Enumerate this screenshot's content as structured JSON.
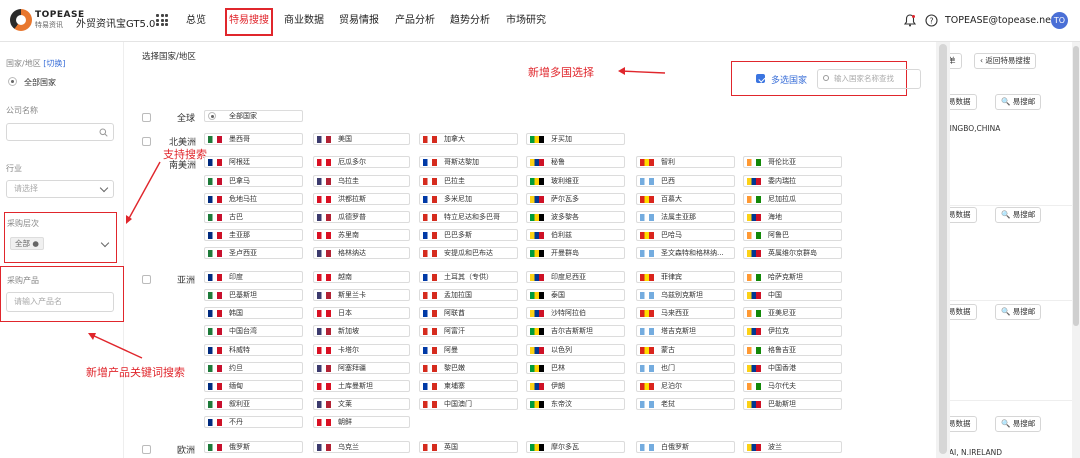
{
  "header": {
    "brand_name": "TOPEASE",
    "brand_sub": "特易资讯",
    "product": "外贸资讯宝GT5.0",
    "nav": [
      "总览",
      "特易搜搜",
      "商业数据",
      "贸易情报",
      "产品分析",
      "趋势分析",
      "市场研究"
    ],
    "active_nav": "特易搜搜",
    "email": "TOPEASE@topease.net",
    "avatar": "TO"
  },
  "left": {
    "region_label": "国家/地区",
    "switch_link": "[切换]",
    "region_value": "全部国家",
    "company_label": "公司名称",
    "industry_label": "行业",
    "industry_placeholder": "请选择",
    "level_label": "采购层次",
    "level_tag": "全部",
    "product_label": "采购产品",
    "product_placeholder": "请输入产品名"
  },
  "main": {
    "title": "选择国家/地区",
    "multi_label": "多选国家",
    "search_placeholder": "输入国家名称查找",
    "annotations": {
      "multi": "新增多国选择",
      "search": "支持搜索",
      "keyword": "新增产品关键词搜索"
    },
    "all_label": "全球",
    "all_value": "全部国家",
    "regions": {
      "north_america": "北美洲",
      "south_america": "南美洲",
      "asia": "亚洲",
      "europe": "欧洲"
    },
    "rows": {
      "na": [
        "墨西哥",
        "美国",
        "加拿大",
        "牙买加"
      ],
      "sa1": [
        "阿根廷",
        "厄瓜多尔",
        "哥斯达黎加",
        "秘鲁",
        "智利",
        "哥伦比亚"
      ],
      "sa2": [
        "巴拿马",
        "乌拉圭",
        "巴拉圭",
        "玻利维亚",
        "巴西",
        "委内瑞拉"
      ],
      "sa3": [
        "危地马拉",
        "洪都拉斯",
        "多米尼加",
        "萨尔瓦多",
        "百慕大",
        "尼加拉瓜"
      ],
      "sa4": [
        "古巴",
        "瓜德罗普",
        "特立尼达和多巴哥",
        "波多黎各",
        "法属圭亚那",
        "海地"
      ],
      "sa5": [
        "圭亚那",
        "苏里南",
        "巴巴多斯",
        "伯利兹",
        "巴哈马",
        "阿鲁巴"
      ],
      "sa6": [
        "圣卢西亚",
        "格林纳达",
        "安提瓜和巴布达",
        "开曼群岛",
        "圣文森特和格林纳...",
        "英属维尔京群岛"
      ],
      "as1": [
        "印度",
        "越南",
        "土耳其（专供）",
        "印度尼西亚",
        "菲律宾",
        "哈萨克斯坦"
      ],
      "as2": [
        "巴基斯坦",
        "斯里兰卡",
        "孟加拉国",
        "泰国",
        "乌兹别克斯坦",
        "中国"
      ],
      "as3": [
        "韩国",
        "日本",
        "阿联酋",
        "沙特阿拉伯",
        "马来西亚",
        "亚美尼亚"
      ],
      "as4": [
        "中国台湾",
        "新加坡",
        "阿富汗",
        "吉尔吉斯斯坦",
        "塔吉克斯坦",
        "伊拉克"
      ],
      "as5": [
        "科威特",
        "卡塔尔",
        "阿曼",
        "以色列",
        "蒙古",
        "格鲁吉亚"
      ],
      "as6": [
        "约旦",
        "阿塞拜疆",
        "黎巴嫩",
        "巴林",
        "也门",
        "中国香港"
      ],
      "as7": [
        "缅甸",
        "土库曼斯坦",
        "柬埔寨",
        "伊朗",
        "尼泊尔",
        "马尔代夫"
      ],
      "as8": [
        "叙利亚",
        "文莱",
        "中国澳门",
        "东帝汶",
        "老挝",
        "巴勒斯坦"
      ],
      "as9": [
        "不丹",
        "朝鲜"
      ],
      "eu1": [
        "俄罗斯",
        "乌克兰",
        "英国",
        "摩尔多瓦",
        "白俄罗斯",
        "波兰"
      ]
    }
  },
  "rightcol": {
    "btn_list": "单",
    "btn_back": "返回特易搜搜",
    "btn_data": "易数据",
    "btn_dept": "易搜邮",
    "text1": "NINGBO,CHINA",
    "text2": "SAI, N.IRELAND"
  },
  "colors": {
    "accent": "#e0262c",
    "link": "#3a6fd8",
    "check": "#3a74e0"
  }
}
